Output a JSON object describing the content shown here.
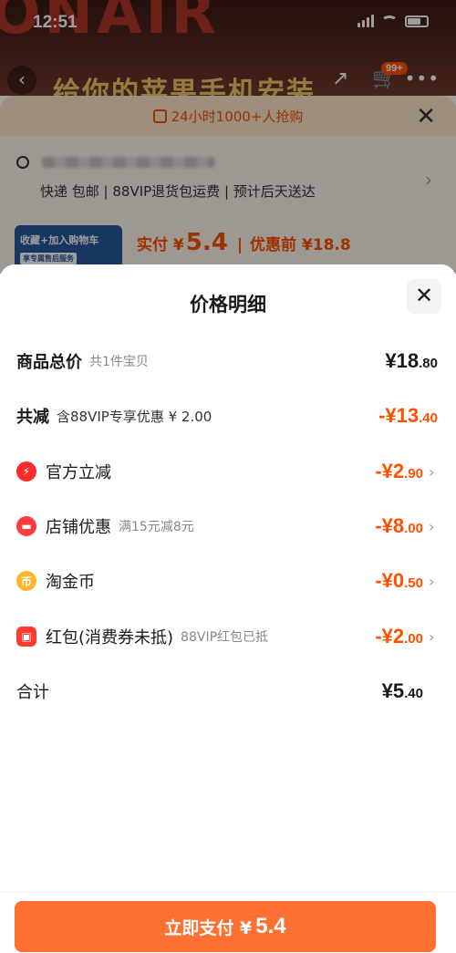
{
  "status": {
    "time": "12:51"
  },
  "product": {
    "title": "给你的苹果手机安装",
    "cart_badge": "99+",
    "promo": "24小时1000+人抢购",
    "shipping": "快递 包邮 | 88VIP退货包运费 | 预计后天送达",
    "thumb_line1": "收藏+加入购物车",
    "thumb_line2": "享专属售后服务",
    "paid_label": "实付 ¥",
    "paid_int": "5.4",
    "before_label": "优惠前 ¥18.8"
  },
  "panel": {
    "title": "价格明细",
    "rows": [
      {
        "label": "商品总价",
        "sub": "共1件宝贝",
        "int": "¥18",
        "dec": ".80"
      },
      {
        "label": "共减",
        "sub": "含88VIP专享优惠 ¥ 2.00",
        "int": "-¥13",
        "dec": ".40"
      },
      {
        "label": "官方立减",
        "sub": "",
        "int": "-¥2",
        "dec": ".90",
        "icon": "bolt-icon"
      },
      {
        "label": "店铺优惠",
        "sub": "满15元减8元",
        "int": "-¥8",
        "dec": ".00",
        "icon": "store-icon"
      },
      {
        "label": "淘金币",
        "sub": "",
        "int": "-¥0",
        "dec": ".50",
        "icon": "coin-icon"
      },
      {
        "label": "红包(消费券未抵)",
        "sub": "88VIP红包已抵",
        "int": "-¥2",
        "dec": ".00",
        "icon": "red-packet-icon"
      },
      {
        "label": "合计",
        "sub": "",
        "int": "¥5",
        "dec": ".40"
      }
    ],
    "pay_label": "立即支付 ¥",
    "pay_amount": "5.4"
  },
  "colors": {
    "accent": "#ff5000",
    "pay_button": "#ff7033"
  }
}
